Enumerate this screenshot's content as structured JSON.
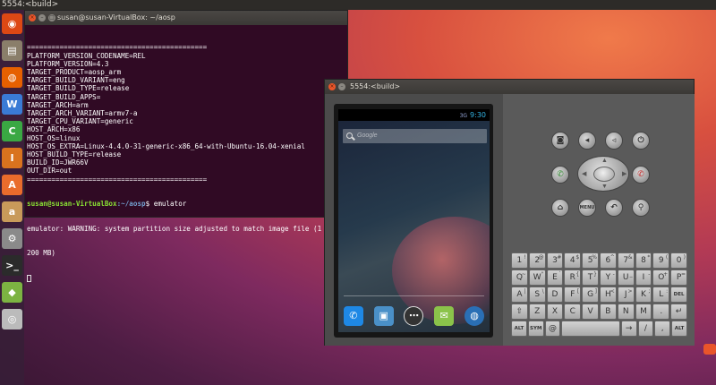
{
  "top_panel": {
    "title": "5554:<build>"
  },
  "launcher": {
    "items": [
      {
        "name": "dash-icon",
        "glyph": "◉",
        "color": "#dd4814"
      },
      {
        "name": "files-icon",
        "glyph": "▤",
        "color": "#8a7e6a"
      },
      {
        "name": "firefox-icon",
        "glyph": "◍",
        "color": "#e66000"
      },
      {
        "name": "writer-icon",
        "glyph": "W",
        "color": "#3a7bd5"
      },
      {
        "name": "calc-icon",
        "glyph": "C",
        "color": "#3aa843"
      },
      {
        "name": "impress-icon",
        "glyph": "I",
        "color": "#d9731e"
      },
      {
        "name": "software-center-icon",
        "glyph": "A",
        "color": "#e96c2c"
      },
      {
        "name": "amazon-icon",
        "glyph": "a",
        "color": "#c89a5a"
      },
      {
        "name": "settings-icon",
        "glyph": "⚙",
        "color": "#8a8a8a"
      },
      {
        "name": "terminal-icon",
        "glyph": ">_",
        "color": "#2b2b2b"
      },
      {
        "name": "android-icon",
        "glyph": "◆",
        "color": "#7cb342"
      },
      {
        "name": "disc-icon",
        "glyph": "◎",
        "color": "#bbbbbb"
      }
    ]
  },
  "terminal": {
    "title": "susan@susan-VirtualBox: ~/aosp",
    "output_lines": [
      "============================================",
      "PLATFORM_VERSION_CODENAME=REL",
      "PLATFORM_VERSION=4.3",
      "TARGET_PRODUCT=aosp_arm",
      "TARGET_BUILD_VARIANT=eng",
      "TARGET_BUILD_TYPE=release",
      "TARGET_BUILD_APPS=",
      "TARGET_ARCH=arm",
      "TARGET_ARCH_VARIANT=armv7-a",
      "TARGET_CPU_VARIANT=generic",
      "HOST_ARCH=x86",
      "HOST_OS=linux",
      "HOST_OS_EXTRA=Linux-4.4.0-31-generic-x86_64-with-Ubuntu-16.04-xenial",
      "HOST_BUILD_TYPE=release",
      "BUILD_ID=JWR66V",
      "OUT_DIR=out",
      "============================================"
    ],
    "prompt_user": "susan@susan-VirtualBox",
    "prompt_path": ":~/aosp",
    "prompt_symbol": "$ ",
    "command": "emulator",
    "warning_line_1": "emulator: WARNING: system partition size adjusted to match image file (1",
    "warning_line_2": "200 MB)"
  },
  "emulator": {
    "title": "5554:<build>",
    "status_time": "9:30",
    "signal": "3G",
    "search_placeholder": "Google",
    "dock_apps": [
      {
        "name": "phone-app-icon",
        "glyph": "✆",
        "color": "#1e88e5"
      },
      {
        "name": "contacts-app-icon",
        "glyph": "▣",
        "color": "#4a90c8"
      },
      {
        "name": "all-apps-icon",
        "glyph": "⋯",
        "color": "#333333"
      },
      {
        "name": "messaging-app-icon",
        "glyph": "✉",
        "color": "#8bc34a"
      },
      {
        "name": "browser-app-icon",
        "glyph": "◍",
        "color": "#2a6fb5"
      }
    ],
    "controls": {
      "camera": "◙",
      "vol_down": "◂",
      "vol_up": "◃",
      "power": "⏻",
      "call": "✆",
      "end_call": "✆",
      "home": "⌂",
      "menu": "MENU",
      "back": "↶",
      "search": "⚲"
    },
    "keyboard": {
      "row1": [
        [
          "1",
          "!"
        ],
        [
          "2",
          "@"
        ],
        [
          "3",
          "#"
        ],
        [
          "4",
          "$"
        ],
        [
          "5",
          "%"
        ],
        [
          "6",
          "^"
        ],
        [
          "7",
          "&"
        ],
        [
          "8",
          "*"
        ],
        [
          "9",
          "("
        ],
        [
          "0",
          ")"
        ]
      ],
      "row2": [
        [
          "Q",
          "~"
        ],
        [
          "W",
          "\""
        ],
        [
          "E",
          "`"
        ],
        [
          "R",
          "{"
        ],
        [
          "T",
          "}"
        ],
        [
          "Y",
          "-"
        ],
        [
          "U",
          "_"
        ],
        [
          "I",
          "-"
        ],
        [
          "O",
          "+"
        ],
        [
          "P",
          "="
        ]
      ],
      "row3": [
        [
          "A",
          "|"
        ],
        [
          "S",
          "\\"
        ],
        [
          "D",
          ""
        ],
        [
          "F",
          "["
        ],
        [
          "G",
          "]"
        ],
        [
          "H",
          "<"
        ],
        [
          "J",
          ">"
        ],
        [
          "K",
          ";"
        ],
        [
          "L",
          ":"
        ],
        [
          "DEL",
          ""
        ]
      ],
      "row4": [
        [
          "⇧",
          ""
        ],
        [
          "Z",
          ""
        ],
        [
          "X",
          ""
        ],
        [
          "C",
          ""
        ],
        [
          "V",
          ""
        ],
        [
          "B",
          ""
        ],
        [
          "N",
          ""
        ],
        [
          "M",
          ""
        ],
        [
          ".",
          ""
        ],
        [
          "↵",
          ""
        ]
      ],
      "row5": [
        [
          "ALT",
          ""
        ],
        [
          "SYM",
          ""
        ],
        [
          "@",
          ""
        ],
        [
          "",
          ""
        ],
        [
          "→",
          ""
        ],
        [
          "/",
          ""
        ],
        [
          ",",
          ""
        ],
        [
          "ALT",
          ""
        ]
      ]
    }
  }
}
